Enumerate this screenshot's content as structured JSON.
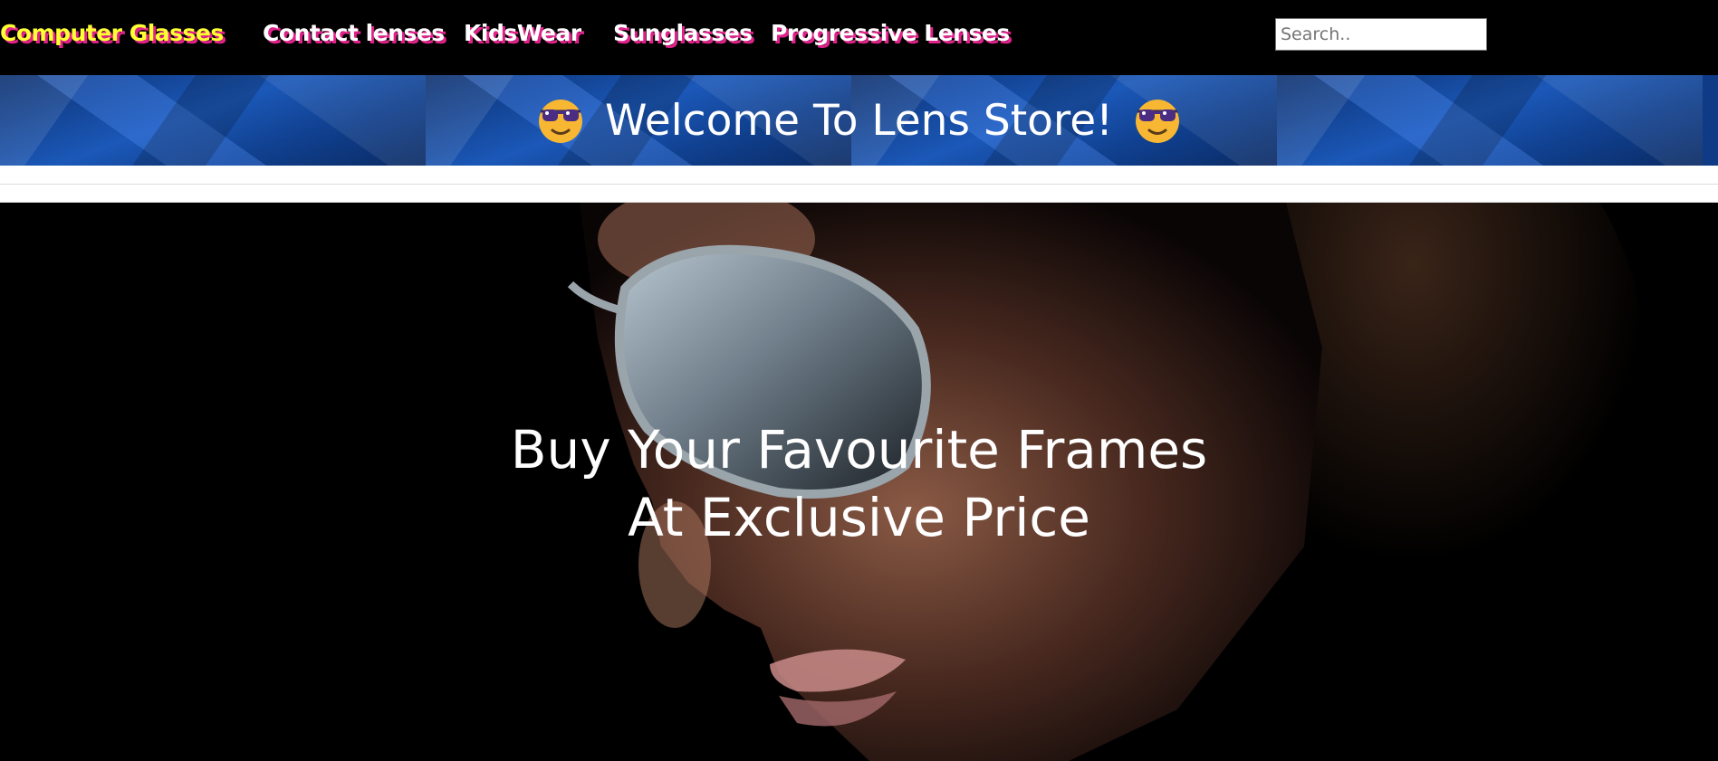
{
  "nav": {
    "items": [
      {
        "label": "Computer Glasses"
      },
      {
        "label": "Contact lenses"
      },
      {
        "label": "KidsWear"
      },
      {
        "label": "Sunglasses"
      },
      {
        "label": "Progressive Lenses"
      }
    ],
    "active_index": 0
  },
  "search": {
    "placeholder": "Search..",
    "value": ""
  },
  "banner": {
    "title": "Welcome To Lens Store!",
    "emoji": "smiling-face-with-sunglasses"
  },
  "hero": {
    "line1": "Buy Your Favourite Frames",
    "line2": "At Exclusive Price"
  },
  "colors": {
    "nav_bg": "#000000",
    "nav_text": "#ffffff",
    "nav_active_text": "#ffff33",
    "nav_shadow": "#e0218a",
    "banner_bg": "#0e3a86",
    "hero_text": "#ffffff"
  }
}
